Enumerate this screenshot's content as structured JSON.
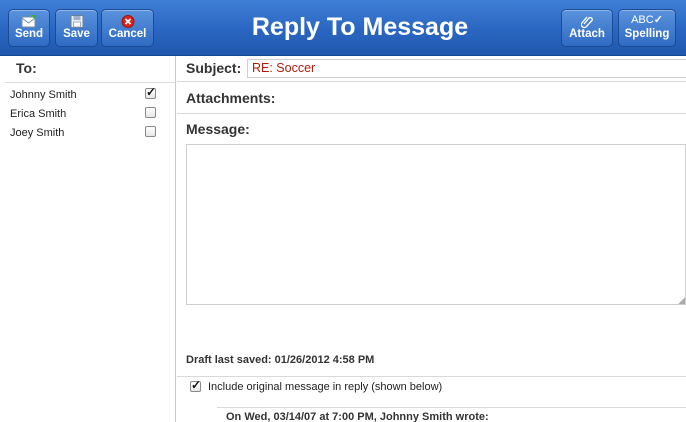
{
  "toolbar": {
    "title": "Reply To Message",
    "send_label": "Send",
    "save_label": "Save",
    "cancel_label": "Cancel",
    "attach_label": "Attach",
    "spelling_label": "Spelling",
    "spelling_icon_text": "ABC"
  },
  "recipients": {
    "heading": "To:",
    "items": [
      {
        "name": "Johnny Smith",
        "checked": true
      },
      {
        "name": "Erica Smith",
        "checked": false
      },
      {
        "name": "Joey Smith",
        "checked": false
      }
    ]
  },
  "compose": {
    "subject_label": "Subject:",
    "subject_value": "RE: Soccer",
    "attachments_label": "Attachments:",
    "message_label": "Message:",
    "message_value": "",
    "draft_status": "Draft last saved: 01/26/2012 4:58 PM",
    "include_original_label": "Include original message in reply (shown below)",
    "include_original_checked": true,
    "quote_header": "On Wed, 03/14/07 at 7:00 PM, Johnny Smith wrote:"
  },
  "colors": {
    "toolbar": "#2a66c1",
    "subject_text": "#b01c0c",
    "cancel_icon": "#d8231d"
  }
}
